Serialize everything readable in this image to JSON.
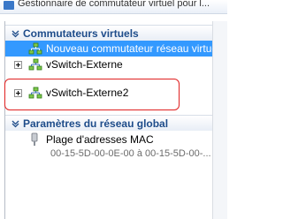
{
  "window": {
    "title": "Gestionnaire de commutateur virtuel pour l..."
  },
  "sections": {
    "virtual_switches": {
      "title": "Commutateurs virtuels"
    },
    "global_network": {
      "title": "Paramètres du réseau global"
    }
  },
  "switches": {
    "new_switch": "Nouveau commutateur réseau virtuel",
    "items": [
      "vSwitch-Externe",
      "vSwitch-Externe2"
    ]
  },
  "mac_range": {
    "label": "Plage d'adresses MAC",
    "value": "00-15-5D-00-0E-00 à 00-15-5D-00-..."
  },
  "colors": {
    "selection": "#3399ff",
    "section_text": "#1e4c8a",
    "highlight": "#e02020"
  },
  "icons": [
    "collapse-chevron-icon",
    "network-switch-icon",
    "expand-plus-icon",
    "mac-address-icon"
  ]
}
